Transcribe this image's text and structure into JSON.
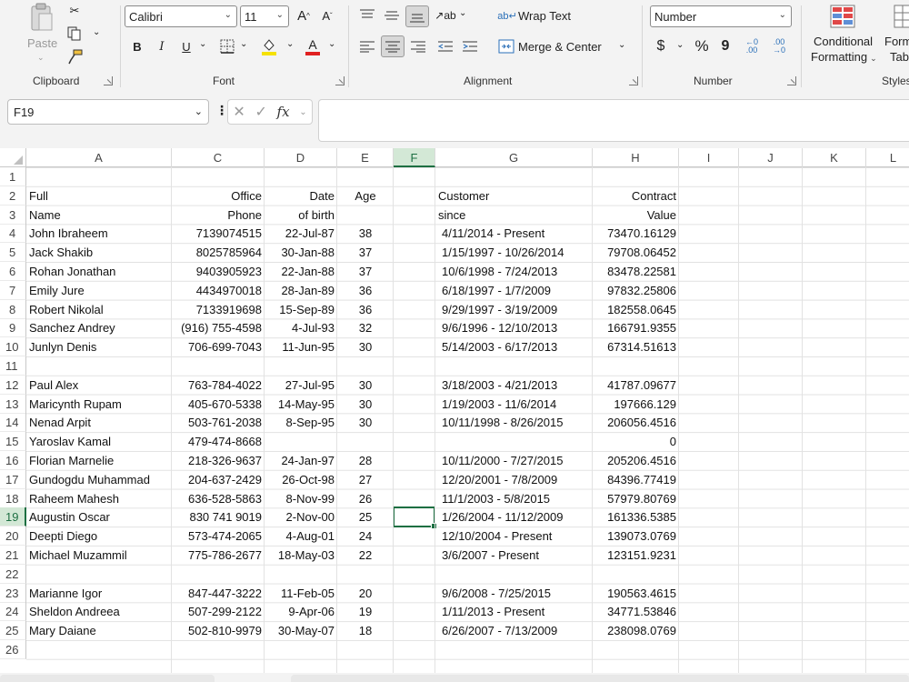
{
  "ribbon": {
    "clipboard": {
      "paste_label": "Paste",
      "group_label": "Clipboard"
    },
    "font": {
      "name": "Calibri",
      "size": "11",
      "group_label": "Font",
      "bold": "B",
      "italic": "I",
      "underline": "U",
      "grow": "A^",
      "shrink": "A˅"
    },
    "alignment": {
      "wrap_text": "Wrap Text",
      "merge_center": "Merge & Center",
      "group_label": "Alignment"
    },
    "number": {
      "format": "Number",
      "group_label": "Number",
      "currency": "$",
      "percent": "%",
      "comma": "9",
      "inc_decimal": "←.0 .00",
      "dec_decimal": ".00 →.0"
    },
    "styles": {
      "conditional_formatting": "Conditional",
      "conditional_formatting_2": "Formatting",
      "format_table": "Form",
      "format_table_2": "Tab",
      "group_label": "Styles"
    }
  },
  "formula_bar": {
    "name_box": "F19",
    "fx": "fx",
    "content": ""
  },
  "columns": [
    "A",
    "C",
    "D",
    "E",
    "F",
    "G",
    "H",
    "I",
    "J",
    "K",
    "L"
  ],
  "selected_column": "F",
  "selected_row": 19,
  "rows": [
    {
      "n": "1",
      "A": "",
      "C": "",
      "D": "",
      "E": "",
      "G": "",
      "H": ""
    },
    {
      "n": "2",
      "A": "Full",
      "C": "Office",
      "D": "Date",
      "E": "Age",
      "G": "Customer",
      "H": "Contract"
    },
    {
      "n": "3",
      "A": "Name",
      "C": "Phone",
      "D": "of birth",
      "E": "",
      "G": "since",
      "H": "Value"
    },
    {
      "n": "4",
      "A": "John Ibraheem",
      "C": "7139074515",
      "D": "22-Jul-87",
      "E": "38",
      "G": "4/11/2014 - Present",
      "H": "73470.16129"
    },
    {
      "n": "5",
      "A": "Jack Shakib",
      "C": "8025785964",
      "D": "30-Jan-88",
      "E": "37",
      "G": "1/15/1997 - 10/26/2014",
      "H": "79708.06452"
    },
    {
      "n": "6",
      "A": "Rohan Jonathan",
      "C": "9403905923",
      "D": "22-Jan-88",
      "E": "37",
      "G": "10/6/1998 - 7/24/2013",
      "H": "83478.22581"
    },
    {
      "n": "7",
      "A": "Emily Jure",
      "C": "4434970018",
      "D": "28-Jan-89",
      "E": "36",
      "G": "6/18/1997 - 1/7/2009",
      "H": "97832.25806"
    },
    {
      "n": "8",
      "A": "Robert Nikolal",
      "C": "7133919698",
      "D": "15-Sep-89",
      "E": "36",
      "G": "9/29/1997 - 3/19/2009",
      "H": "182558.0645"
    },
    {
      "n": "9",
      "A": "Sanchez Andrey",
      "C": "(916) 755-4598",
      "D": "4-Jul-93",
      "E": "32",
      "G": "9/6/1996 - 12/10/2013",
      "H": "166791.9355"
    },
    {
      "n": "10",
      "A": "Junlyn Denis",
      "C": "706-699-7043",
      "D": "11-Jun-95",
      "E": "30",
      "G": "5/14/2003 - 6/17/2013",
      "H": "67314.51613"
    },
    {
      "n": "11",
      "A": "",
      "C": "",
      "D": "",
      "E": "",
      "G": "",
      "H": ""
    },
    {
      "n": "12",
      "A": "Paul Alex",
      "C": "763-784-4022",
      "D": "27-Jul-95",
      "E": "30",
      "G": "3/18/2003 - 4/21/2013",
      "H": "41787.09677"
    },
    {
      "n": "13",
      "A": "Maricynth Rupam",
      "C": "405-670-5338",
      "D": "14-May-95",
      "E": "30",
      "G": "1/19/2003 - 11/6/2014",
      "H": "197666.129"
    },
    {
      "n": "14",
      "A": "Nenad Arpit",
      "C": "503-761-2038",
      "D": "8-Sep-95",
      "E": "30",
      "G": "10/11/1998 - 8/26/2015",
      "H": "206056.4516"
    },
    {
      "n": "15",
      "A": "Yaroslav Kamal",
      "C": "479-474-8668",
      "D": "",
      "E": "",
      "G": "",
      "H": "0"
    },
    {
      "n": "16",
      "A": "Florian Marnelie",
      "C": "218-326-9637",
      "D": "24-Jan-97",
      "E": "28",
      "G": "10/11/2000 - 7/27/2015",
      "H": "205206.4516"
    },
    {
      "n": "17",
      "A": "Gundogdu Muhammad",
      "C": "204-637-2429",
      "D": "26-Oct-98",
      "E": "27",
      "G": "12/20/2001 - 7/8/2009",
      "H": "84396.77419"
    },
    {
      "n": "18",
      "A": "Raheem Mahesh",
      "C": "636-528-5863",
      "D": "8-Nov-99",
      "E": "26",
      "G": "11/1/2003 - 5/8/2015",
      "H": "57979.80769"
    },
    {
      "n": "19",
      "A": "Augustin Oscar",
      "C": "830 741 9019",
      "D": "2-Nov-00",
      "E": "25",
      "G": "1/26/2004 - 11/12/2009",
      "H": "161336.5385"
    },
    {
      "n": "20",
      "A": "Deepti Diego",
      "C": "573-474-2065",
      "D": "4-Aug-01",
      "E": "24",
      "G": "12/10/2004 - Present",
      "H": "139073.0769"
    },
    {
      "n": "21",
      "A": "Michael Muzammil",
      "C": "775-786-2677",
      "D": "18-May-03",
      "E": "22",
      "G": "3/6/2007 - Present",
      "H": "123151.9231"
    },
    {
      "n": "22",
      "A": "",
      "C": "",
      "D": "",
      "E": "",
      "G": "",
      "H": ""
    },
    {
      "n": "23",
      "A": "Marianne Igor",
      "C": "847-447-3222",
      "D": "11-Feb-05",
      "E": "20",
      "G": "9/6/2008 - 7/25/2015",
      "H": "190563.4615"
    },
    {
      "n": "24",
      "A": "Sheldon Andreea",
      "C": "507-299-2122",
      "D": "9-Apr-06",
      "E": "19",
      "G": "1/11/2013 - Present",
      "H": "34771.53846"
    },
    {
      "n": "25",
      "A": "Mary Daiane",
      "C": "502-810-9979",
      "D": "30-May-07",
      "E": "18",
      "G": "6/26/2007 - 7/13/2009",
      "H": "238098.0769"
    },
    {
      "n": "26",
      "A": "",
      "C": "",
      "D": "",
      "E": "",
      "G": "",
      "H": ""
    }
  ]
}
